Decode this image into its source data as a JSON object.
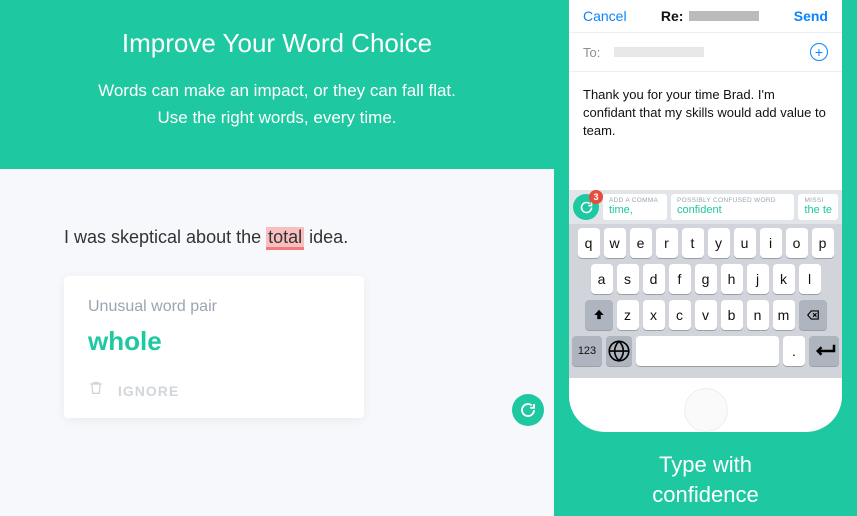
{
  "left": {
    "title": "Improve Your Word Choice",
    "subtitle_line1": "Words can make an impact, or they can fall flat.",
    "subtitle_line2": "Use the right words, every time.",
    "sentence_before": "I was skeptical about the ",
    "sentence_highlight": "total",
    "sentence_after": " idea.",
    "card": {
      "title": "Unusual word pair",
      "suggestion": "whole",
      "ignore": "IGNORE"
    }
  },
  "right": {
    "tagline_line1": "Type with",
    "tagline_line2": "confidence",
    "phone": {
      "nav": {
        "cancel": "Cancel",
        "title_prefix": "Re:",
        "send": "Send"
      },
      "to_label": "To:",
      "body": "Thank you for your time Brad. I'm confidant that my skills would add value to team.",
      "grammarly_badge": "3",
      "suggestions": [
        {
          "hint": "ADD A COMMA",
          "text": "time,"
        },
        {
          "hint": "POSSIBLY CONFUSED WORD",
          "text": "confident"
        },
        {
          "hint": "MISSI",
          "text": "the te"
        }
      ],
      "keys_row1": [
        "q",
        "w",
        "e",
        "r",
        "t",
        "y",
        "u",
        "i",
        "o",
        "p"
      ],
      "keys_row2": [
        "a",
        "s",
        "d",
        "f",
        "g",
        "h",
        "j",
        "k",
        "l"
      ],
      "keys_row3": [
        "z",
        "x",
        "c",
        "v",
        "b",
        "n",
        "m"
      ],
      "num_key": "123",
      "period_key": "."
    }
  },
  "colors": {
    "accent": "#1EC8A0"
  }
}
